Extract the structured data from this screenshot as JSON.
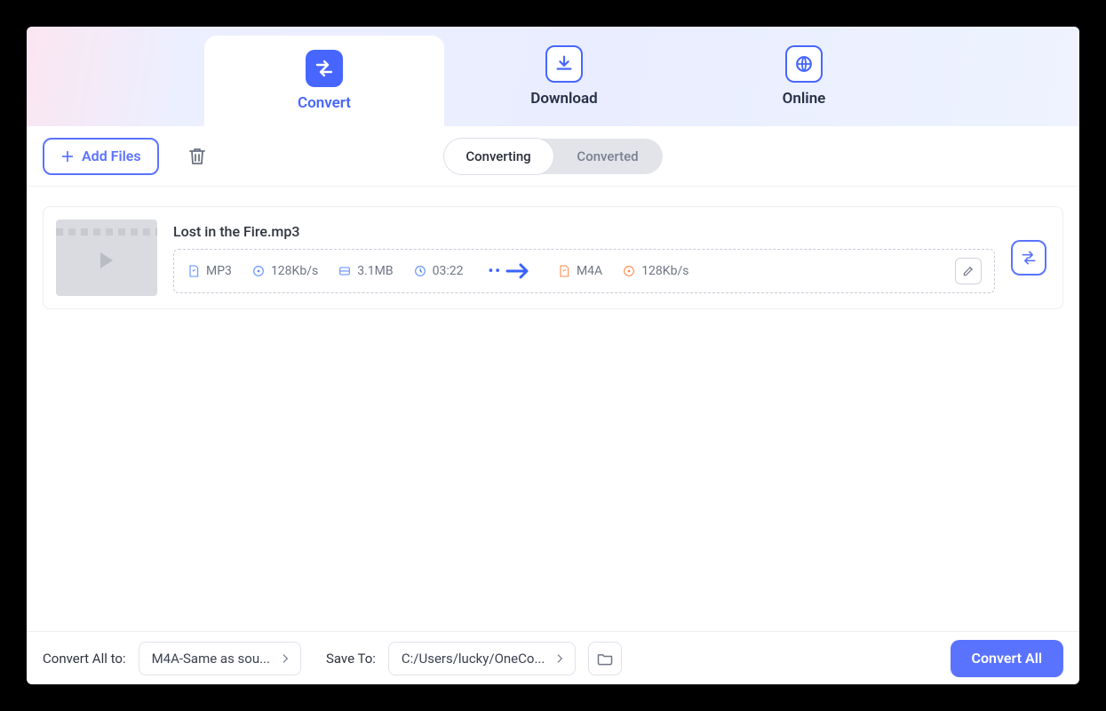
{
  "nav": {
    "convert": "Convert",
    "download": "Download",
    "online": "Online"
  },
  "toolbar": {
    "add_files": "Add Files",
    "seg_converting": "Converting",
    "seg_converted": "Converted"
  },
  "file": {
    "name": "Lost in the Fire.mp3",
    "src_format": "MP3",
    "src_bitrate": "128Kb/s",
    "size": "3.1MB",
    "duration": "03:22",
    "dst_format": "M4A",
    "dst_bitrate": "128Kb/s"
  },
  "bottom": {
    "convert_all_to_label": "Convert All to:",
    "convert_all_to_value": "M4A-Same as sou...",
    "save_to_label": "Save To:",
    "save_to_value": "C:/Users/lucky/OneCo...",
    "convert_all_btn": "Convert All"
  }
}
